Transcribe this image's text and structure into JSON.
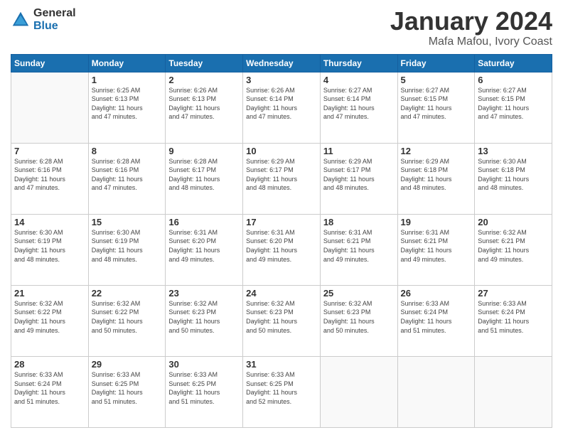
{
  "logo": {
    "general": "General",
    "blue": "Blue"
  },
  "title": {
    "month": "January 2024",
    "location": "Mafa Mafou, Ivory Coast"
  },
  "headers": [
    "Sunday",
    "Monday",
    "Tuesday",
    "Wednesday",
    "Thursday",
    "Friday",
    "Saturday"
  ],
  "weeks": [
    [
      {
        "day": "",
        "info": ""
      },
      {
        "day": "1",
        "info": "Sunrise: 6:25 AM\nSunset: 6:13 PM\nDaylight: 11 hours\nand 47 minutes."
      },
      {
        "day": "2",
        "info": "Sunrise: 6:26 AM\nSunset: 6:13 PM\nDaylight: 11 hours\nand 47 minutes."
      },
      {
        "day": "3",
        "info": "Sunrise: 6:26 AM\nSunset: 6:14 PM\nDaylight: 11 hours\nand 47 minutes."
      },
      {
        "day": "4",
        "info": "Sunrise: 6:27 AM\nSunset: 6:14 PM\nDaylight: 11 hours\nand 47 minutes."
      },
      {
        "day": "5",
        "info": "Sunrise: 6:27 AM\nSunset: 6:15 PM\nDaylight: 11 hours\nand 47 minutes."
      },
      {
        "day": "6",
        "info": "Sunrise: 6:27 AM\nSunset: 6:15 PM\nDaylight: 11 hours\nand 47 minutes."
      }
    ],
    [
      {
        "day": "7",
        "info": "Sunrise: 6:28 AM\nSunset: 6:16 PM\nDaylight: 11 hours\nand 47 minutes."
      },
      {
        "day": "8",
        "info": "Sunrise: 6:28 AM\nSunset: 6:16 PM\nDaylight: 11 hours\nand 47 minutes."
      },
      {
        "day": "9",
        "info": "Sunrise: 6:28 AM\nSunset: 6:17 PM\nDaylight: 11 hours\nand 48 minutes."
      },
      {
        "day": "10",
        "info": "Sunrise: 6:29 AM\nSunset: 6:17 PM\nDaylight: 11 hours\nand 48 minutes."
      },
      {
        "day": "11",
        "info": "Sunrise: 6:29 AM\nSunset: 6:17 PM\nDaylight: 11 hours\nand 48 minutes."
      },
      {
        "day": "12",
        "info": "Sunrise: 6:29 AM\nSunset: 6:18 PM\nDaylight: 11 hours\nand 48 minutes."
      },
      {
        "day": "13",
        "info": "Sunrise: 6:30 AM\nSunset: 6:18 PM\nDaylight: 11 hours\nand 48 minutes."
      }
    ],
    [
      {
        "day": "14",
        "info": "Sunrise: 6:30 AM\nSunset: 6:19 PM\nDaylight: 11 hours\nand 48 minutes."
      },
      {
        "day": "15",
        "info": "Sunrise: 6:30 AM\nSunset: 6:19 PM\nDaylight: 11 hours\nand 48 minutes."
      },
      {
        "day": "16",
        "info": "Sunrise: 6:31 AM\nSunset: 6:20 PM\nDaylight: 11 hours\nand 49 minutes."
      },
      {
        "day": "17",
        "info": "Sunrise: 6:31 AM\nSunset: 6:20 PM\nDaylight: 11 hours\nand 49 minutes."
      },
      {
        "day": "18",
        "info": "Sunrise: 6:31 AM\nSunset: 6:21 PM\nDaylight: 11 hours\nand 49 minutes."
      },
      {
        "day": "19",
        "info": "Sunrise: 6:31 AM\nSunset: 6:21 PM\nDaylight: 11 hours\nand 49 minutes."
      },
      {
        "day": "20",
        "info": "Sunrise: 6:32 AM\nSunset: 6:21 PM\nDaylight: 11 hours\nand 49 minutes."
      }
    ],
    [
      {
        "day": "21",
        "info": "Sunrise: 6:32 AM\nSunset: 6:22 PM\nDaylight: 11 hours\nand 49 minutes."
      },
      {
        "day": "22",
        "info": "Sunrise: 6:32 AM\nSunset: 6:22 PM\nDaylight: 11 hours\nand 50 minutes."
      },
      {
        "day": "23",
        "info": "Sunrise: 6:32 AM\nSunset: 6:23 PM\nDaylight: 11 hours\nand 50 minutes."
      },
      {
        "day": "24",
        "info": "Sunrise: 6:32 AM\nSunset: 6:23 PM\nDaylight: 11 hours\nand 50 minutes."
      },
      {
        "day": "25",
        "info": "Sunrise: 6:32 AM\nSunset: 6:23 PM\nDaylight: 11 hours\nand 50 minutes."
      },
      {
        "day": "26",
        "info": "Sunrise: 6:33 AM\nSunset: 6:24 PM\nDaylight: 11 hours\nand 51 minutes."
      },
      {
        "day": "27",
        "info": "Sunrise: 6:33 AM\nSunset: 6:24 PM\nDaylight: 11 hours\nand 51 minutes."
      }
    ],
    [
      {
        "day": "28",
        "info": "Sunrise: 6:33 AM\nSunset: 6:24 PM\nDaylight: 11 hours\nand 51 minutes."
      },
      {
        "day": "29",
        "info": "Sunrise: 6:33 AM\nSunset: 6:25 PM\nDaylight: 11 hours\nand 51 minutes."
      },
      {
        "day": "30",
        "info": "Sunrise: 6:33 AM\nSunset: 6:25 PM\nDaylight: 11 hours\nand 51 minutes."
      },
      {
        "day": "31",
        "info": "Sunrise: 6:33 AM\nSunset: 6:25 PM\nDaylight: 11 hours\nand 52 minutes."
      },
      {
        "day": "",
        "info": ""
      },
      {
        "day": "",
        "info": ""
      },
      {
        "day": "",
        "info": ""
      }
    ]
  ]
}
